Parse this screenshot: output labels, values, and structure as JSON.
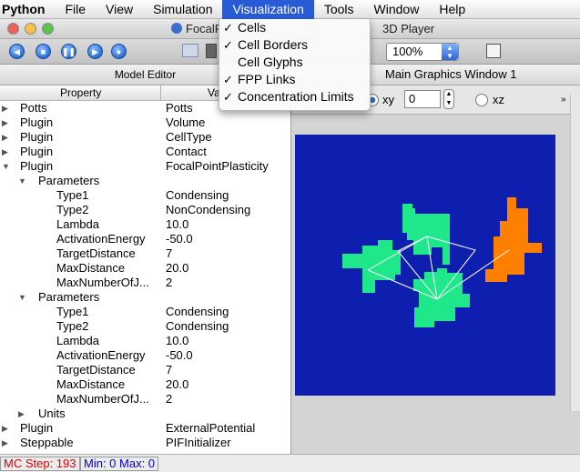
{
  "menubar": {
    "app": "Python",
    "items": [
      "File",
      "View",
      "Simulation",
      "Visualization",
      "Tools",
      "Window",
      "Help"
    ]
  },
  "window": {
    "title": "FocalPoi",
    "title_tail": "3D Player"
  },
  "toolbar": {
    "zoom_value": "100%"
  },
  "model_editor": {
    "title": "Model Editor",
    "col_property": "Property",
    "col_value": "Va",
    "rows": [
      {
        "prop": "Potts",
        "val": "Potts"
      },
      {
        "prop": "Plugin",
        "val": "Volume"
      },
      {
        "prop": "Plugin",
        "val": "CellType"
      },
      {
        "prop": "Plugin",
        "val": "Contact"
      },
      {
        "prop": "Plugin",
        "val": "FocalPointPlasticity"
      },
      {
        "prop": "Parameters",
        "val": ""
      },
      {
        "prop": "Type1",
        "val": "Condensing"
      },
      {
        "prop": "Type2",
        "val": "NonCondensing"
      },
      {
        "prop": "Lambda",
        "val": "10.0"
      },
      {
        "prop": "ActivationEnergy",
        "val": "-50.0"
      },
      {
        "prop": "TargetDistance",
        "val": "7"
      },
      {
        "prop": "MaxDistance",
        "val": "20.0"
      },
      {
        "prop": "MaxNumberOfJ...",
        "val": "2"
      },
      {
        "prop": "Parameters",
        "val": ""
      },
      {
        "prop": "Type1",
        "val": "Condensing"
      },
      {
        "prop": "Type2",
        "val": "Condensing"
      },
      {
        "prop": "Lambda",
        "val": "10.0"
      },
      {
        "prop": "ActivationEnergy",
        "val": "-50.0"
      },
      {
        "prop": "TargetDistance",
        "val": "7"
      },
      {
        "prop": "MaxDistance",
        "val": "20.0"
      },
      {
        "prop": "MaxNumberOfJ...",
        "val": "2"
      },
      {
        "prop": "Units",
        "val": ""
      },
      {
        "prop": "Plugin",
        "val": "ExternalPotential"
      },
      {
        "prop": "Steppable",
        "val": "PIFInitializer"
      }
    ]
  },
  "graphics": {
    "title": "Main Graphics Window 1",
    "plane_xy": "xy",
    "plane_xz": "xz",
    "plane_value": "0"
  },
  "visualization_menu": {
    "items": [
      {
        "label": "Cells",
        "checked": true
      },
      {
        "label": "Cell Borders",
        "checked": true
      },
      {
        "label": "Cell Glyphs",
        "checked": false
      },
      {
        "label": "FPP Links",
        "checked": true
      },
      {
        "label": "Concentration Limits",
        "checked": true
      }
    ]
  },
  "status": {
    "mc_step": "MC Step: 193",
    "minmax": "Min: 0 Max: 0"
  },
  "colors": {
    "canvas_bg": "#0e1fb0",
    "condensing_cell": "#1fe88a",
    "noncondensing_cell": "#ff8000",
    "fpp_link": "#ffffff",
    "menu_highlight": "#2a5bd7"
  }
}
